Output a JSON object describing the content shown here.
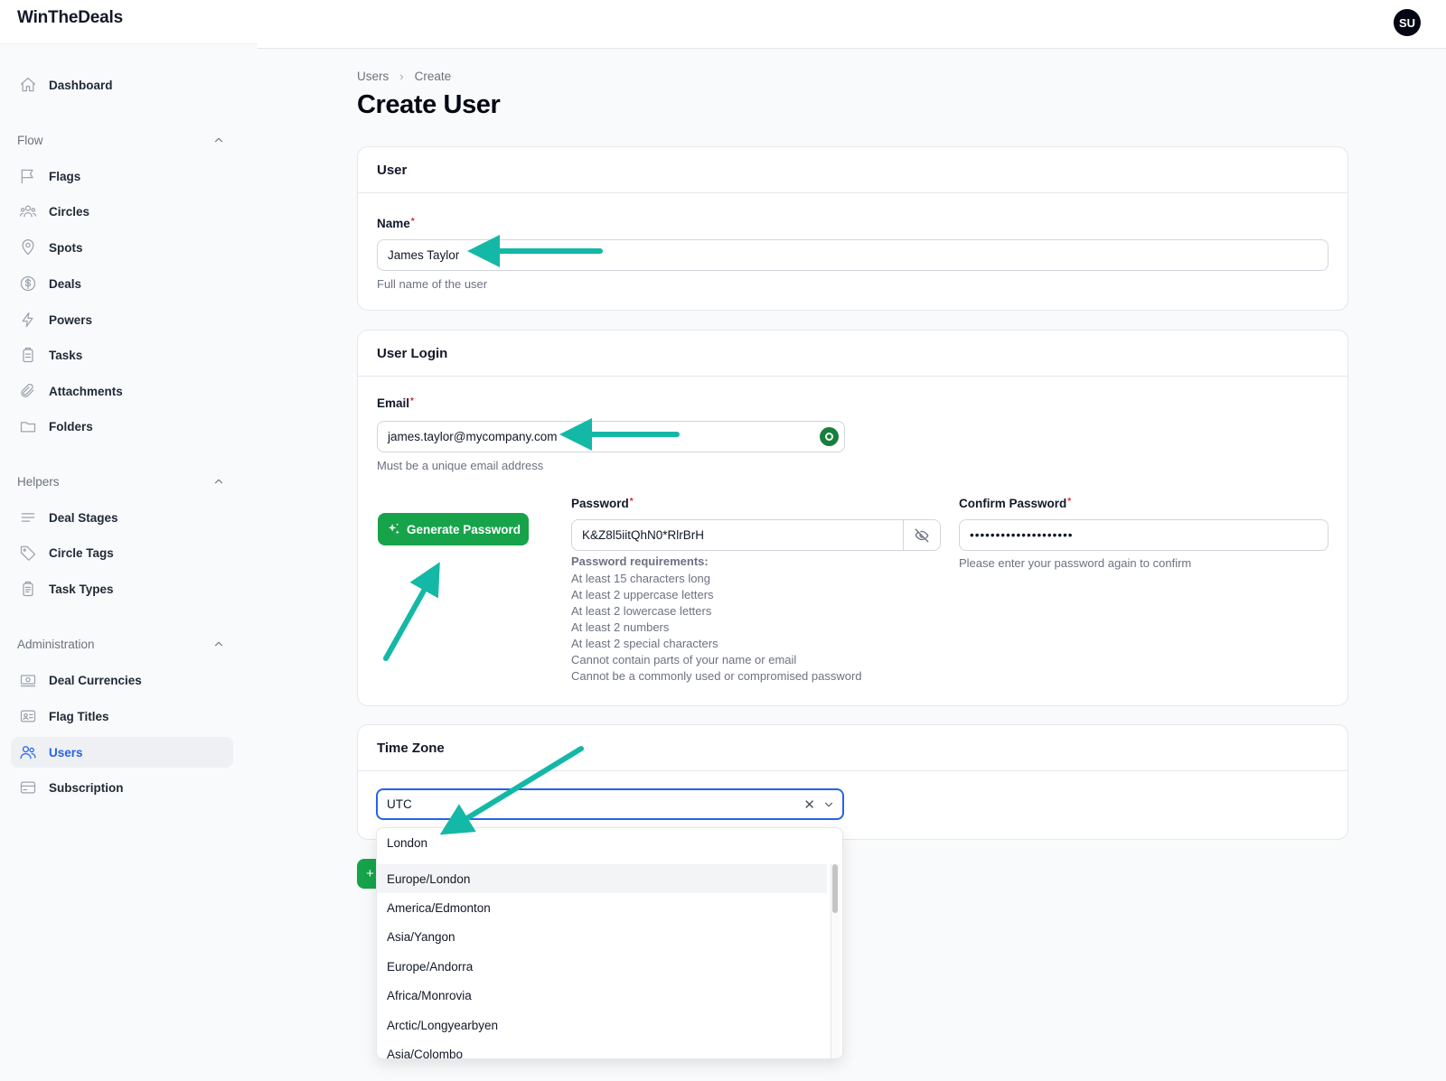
{
  "app": {
    "brand": "WinTheDeals",
    "user_initials": "SU"
  },
  "sidebar": {
    "dashboard": "Dashboard",
    "groups": {
      "flow": "Flow",
      "helpers": "Helpers",
      "administration": "Administration"
    },
    "flow_items": [
      "Flags",
      "Circles",
      "Spots",
      "Deals",
      "Powers",
      "Tasks",
      "Attachments",
      "Folders"
    ],
    "helper_items": [
      "Deal Stages",
      "Circle Tags",
      "Task Types"
    ],
    "admin_items": [
      "Deal Currencies",
      "Flag Titles",
      "Users",
      "Subscription"
    ],
    "active_item": "Users"
  },
  "breadcrumb": {
    "parent": "Users",
    "current": "Create"
  },
  "page": {
    "title": "Create User"
  },
  "user_section": {
    "title": "User",
    "name_label": "Name",
    "name_value": "James Taylor",
    "name_help": "Full name of the user"
  },
  "login_section": {
    "title": "User Login",
    "email_label": "Email",
    "email_value": "james.taylor@mycompany.com",
    "email_help": "Must be a unique email address",
    "generate_label": "Generate Password",
    "password_label": "Password",
    "password_value": "K&Z8l5iitQhN0*RlrBrH",
    "confirm_label": "Confirm Password",
    "confirm_value": "••••••••••••••••••••",
    "confirm_help": "Please enter your password again to confirm",
    "requirements_title": "Password requirements:",
    "requirements": [
      "At least 15 characters long",
      "At least 2 uppercase letters",
      "At least 2 lowercase letters",
      "At least 2 numbers",
      "At least 2 special characters",
      "Cannot contain parts of your name or email",
      "Cannot be a commonly used or compromised password"
    ]
  },
  "timezone_section": {
    "title": "Time Zone",
    "selected": "UTC",
    "search_text": "London",
    "options": [
      "Europe/London",
      "America/Edmonton",
      "Asia/Yangon",
      "Europe/Andorra",
      "Africa/Monrovia",
      "Arctic/Longyearbyen",
      "Asia/Colombo"
    ],
    "highlighted_option": "Europe/London"
  },
  "colors": {
    "primary_green": "#16a34a",
    "active_blue": "#2563eb",
    "annotation_teal": "#14b8a6"
  }
}
